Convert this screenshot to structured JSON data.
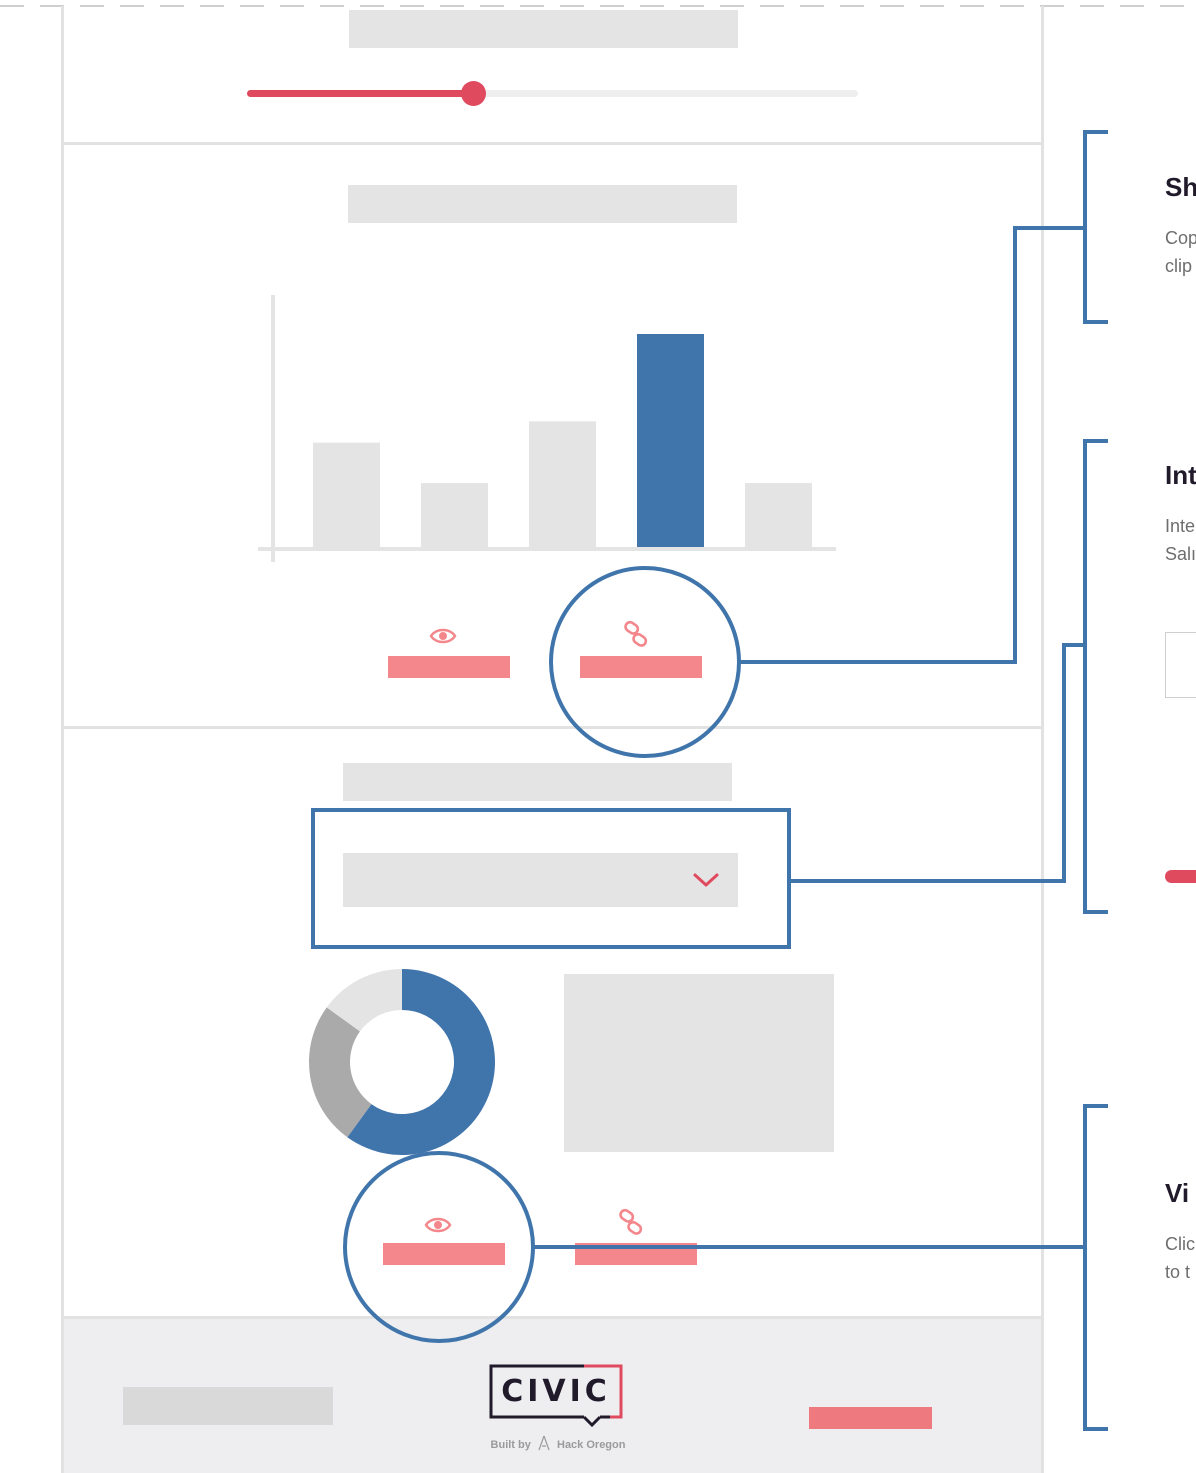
{
  "slider": {
    "level": 0.37
  },
  "bar_chart": {
    "bars": [
      {
        "value": 0.49,
        "highlighted": false
      },
      {
        "value": 0.3,
        "highlighted": false
      },
      {
        "value": 0.59,
        "highlighted": false
      },
      {
        "value": 1.0,
        "highlighted": true
      },
      {
        "value": 0.3,
        "highlighted": false
      }
    ]
  },
  "donut": {
    "segments": [
      {
        "share": 0.6,
        "color": "#4075ac"
      },
      {
        "share": 0.25,
        "color": "#aaaaaa"
      },
      {
        "share": 0.15,
        "color": "#e4e4e4"
      }
    ]
  },
  "icons": {
    "view": "eye-icon",
    "share": "link-icon",
    "dropdown": "chevron-down-icon",
    "footer_person": "person-icon"
  },
  "callouts": [
    {
      "title": "Sh",
      "description": "Cop\nclip"
    },
    {
      "title": "Int",
      "description": "Inte\nSalı"
    },
    {
      "title": "Vi",
      "description": "Clic\nto t"
    }
  ],
  "footer": {
    "logo_text": "CIVIC",
    "built_by_prefix": "Built by",
    "built_by_org": "Hack Oregon"
  },
  "colors": {
    "accent_red": "#e04a5f",
    "accent_pink": "#f3878b",
    "callout_blue": "#4075ac",
    "placeholder_gray": "#e4e4e4",
    "footer_bg": "#eeeef1",
    "dark": "#211a2b"
  }
}
